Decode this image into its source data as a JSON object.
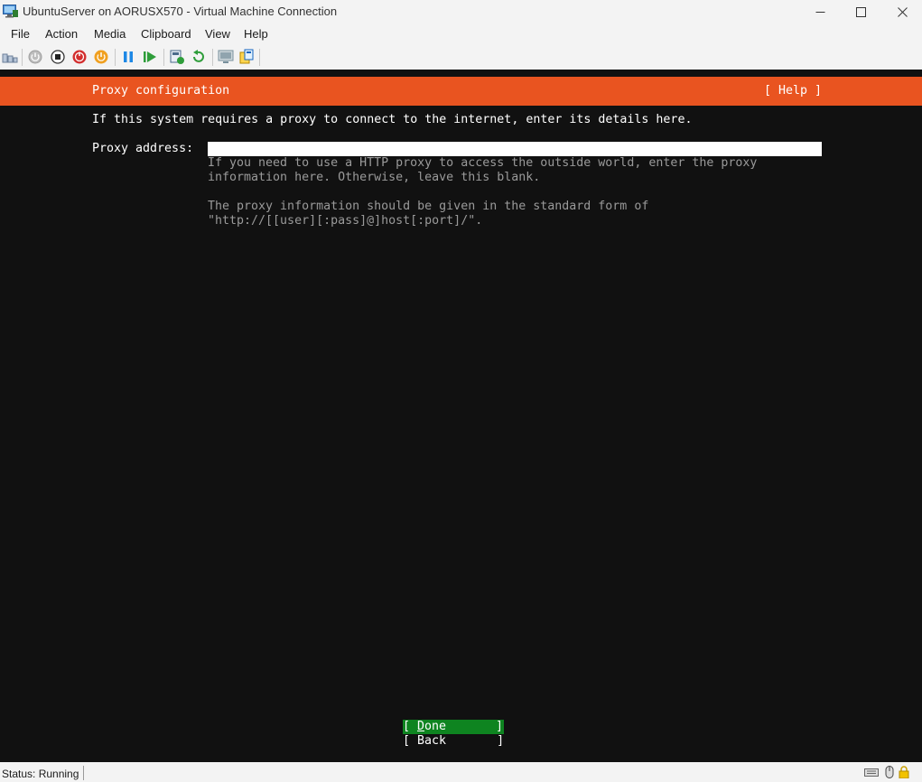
{
  "window": {
    "title": "UbuntuServer on AORUSX570 - Virtual Machine Connection",
    "icons": [
      "vm-connection-app-icon",
      "minimize-icon",
      "maximize-icon",
      "close-icon"
    ]
  },
  "menu": {
    "file": "File",
    "action": "Action",
    "media": "Media",
    "clipboard": "Clipboard",
    "view": "View",
    "help": "Help"
  },
  "toolbar": {
    "icons": [
      "ctrl-alt-del-icon",
      "start-icon",
      "turn-off-icon",
      "shutdown-icon",
      "save-icon",
      "pause-icon",
      "resume-icon",
      "checkpoint-icon",
      "revert-icon",
      "enhanced-session-icon",
      "share-icon"
    ]
  },
  "installer": {
    "header_title": "Proxy configuration",
    "help_label": "[ Help ]",
    "intro": "If this system requires a proxy to connect to the internet, enter its details here.",
    "proxy_label": "Proxy address:",
    "proxy_value": "",
    "help_line1": "If you need to use a HTTP proxy to access the outside world, enter the proxy",
    "help_line2": "information here. Otherwise, leave this blank.",
    "help_line3": "The proxy information should be given in the standard form of",
    "help_line4": "\"http://[[user][:pass]@]host[:port]/\".",
    "done_open": "[ ",
    "done_underlined": "D",
    "done_rest": "one",
    "done_close": "]",
    "back_label": "[ Back       ]"
  },
  "status": {
    "text": "Status: Running",
    "tray_icons": [
      "keyboard-icon",
      "mouse-icon",
      "lock-icon"
    ]
  },
  "colors": {
    "banner": "#e95420",
    "selected_button": "#0e8420",
    "screen_bg": "#111111",
    "help_text": "#9a9a9a"
  }
}
